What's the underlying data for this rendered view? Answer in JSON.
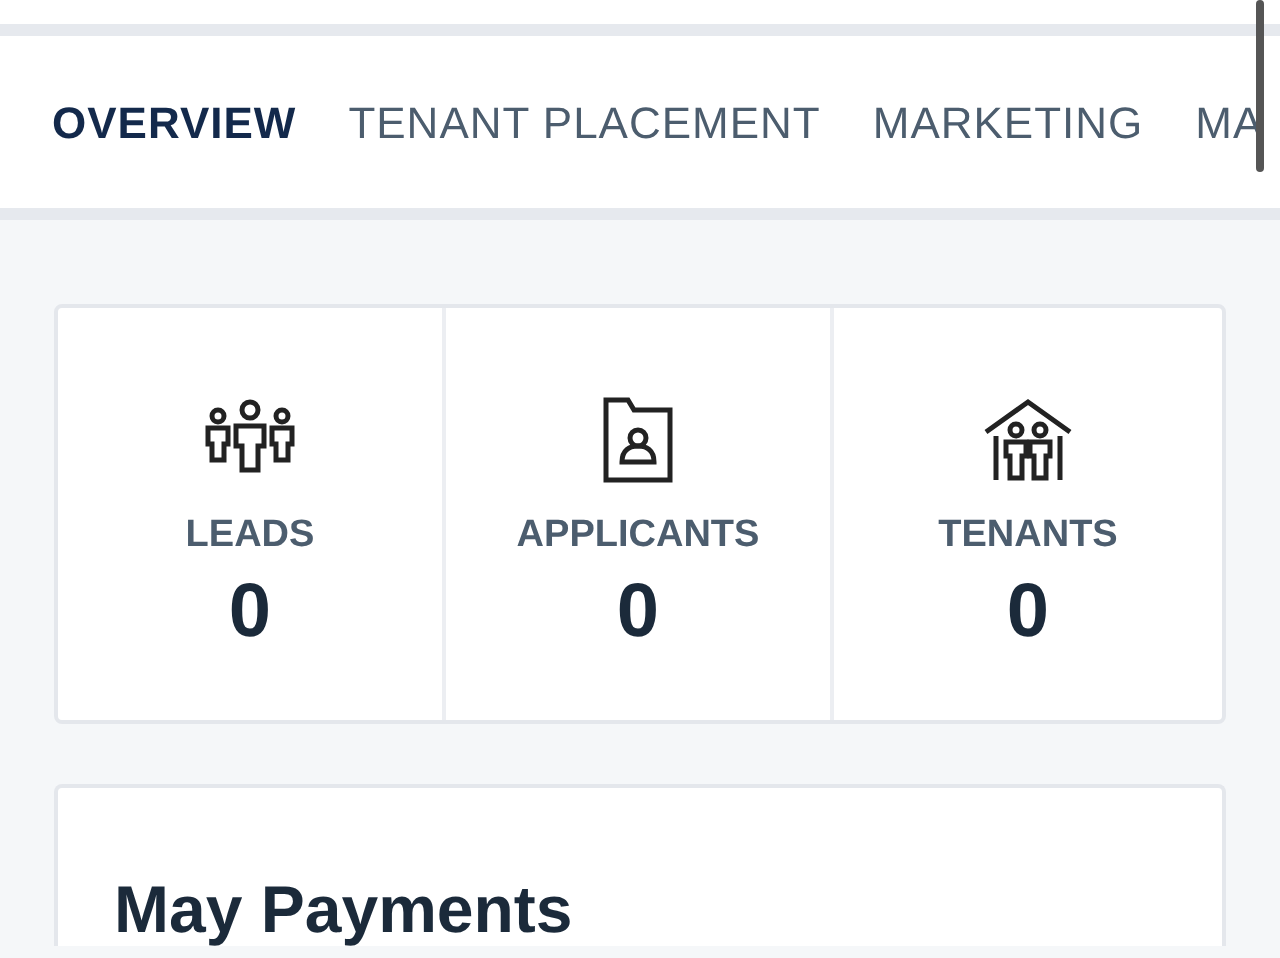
{
  "tabs": [
    {
      "label": "OVERVIEW",
      "selected": true
    },
    {
      "label": "TENANT PLACEMENT",
      "selected": false
    },
    {
      "label": "MARKETING",
      "selected": false
    },
    {
      "label": "MA",
      "selected": false
    }
  ],
  "stats": [
    {
      "kind": "leads",
      "label": "LEADS",
      "value": "0"
    },
    {
      "kind": "applicants",
      "label": "APPLICANTS",
      "value": "0"
    },
    {
      "kind": "tenants",
      "label": "TENANTS",
      "value": "0"
    }
  ],
  "payments": {
    "title": "May Payments"
  }
}
